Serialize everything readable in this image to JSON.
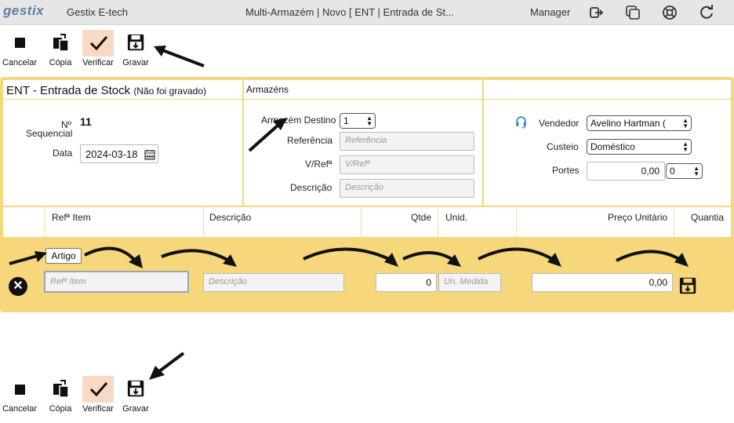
{
  "topbar": {
    "logo": "gestix",
    "company": "Gestix E-tech",
    "window_title": "Multi-Armazém | Novo [ ENT | Entrada de St...",
    "user": "Manager",
    "icons": [
      "logout-icon",
      "windows-icon",
      "help-icon",
      "refresh-icon"
    ]
  },
  "toolbar": {
    "cancel_label": "Cancelar",
    "copy_label": "Cópia",
    "verify_label": "Verificar",
    "save_label": "Gravar"
  },
  "document": {
    "title": "ENT - Entrada de Stock",
    "status": "(Não foi gravado)",
    "warehouses_heading": "Armazéns",
    "seq_label_1": "Nº",
    "seq_label_2": "Sequencial",
    "seq_value": "11",
    "date_label": "Data",
    "date_value": "2024-03-18",
    "dest_wh_label": "Armazém Destino",
    "dest_wh_value": "1",
    "reference_label": "Referência",
    "reference_placeholder": "Referência",
    "vref_label": "V/Refª",
    "vref_placeholder": "V/Refª",
    "description_label": "Descrição",
    "description_placeholder": "Descrição",
    "seller_label": "Vendedor",
    "seller_value": "Avelino Hartman (",
    "costing_label": "Custeio",
    "costing_value": "Doméstico",
    "shipping_label": "Portes",
    "shipping_value": "0,00",
    "shipping_select": "0"
  },
  "grid": {
    "columns": [
      "Refª Item",
      "Descrição",
      "Qtde",
      "Unid.",
      "Preço Unitário",
      "Quantia"
    ],
    "artigo_label": "Artigo",
    "item_ref_placeholder": "Refª Item",
    "desc_placeholder": "Descrição",
    "qty_value": "0",
    "unit_placeholder": "Un. Medida",
    "price_value": "0,00"
  },
  "colors": {
    "accent_yellow": "#f6d77c",
    "topbar": "#e6e6e6",
    "active_button": "#f7d9c4",
    "logo": "#5b7fa6"
  }
}
